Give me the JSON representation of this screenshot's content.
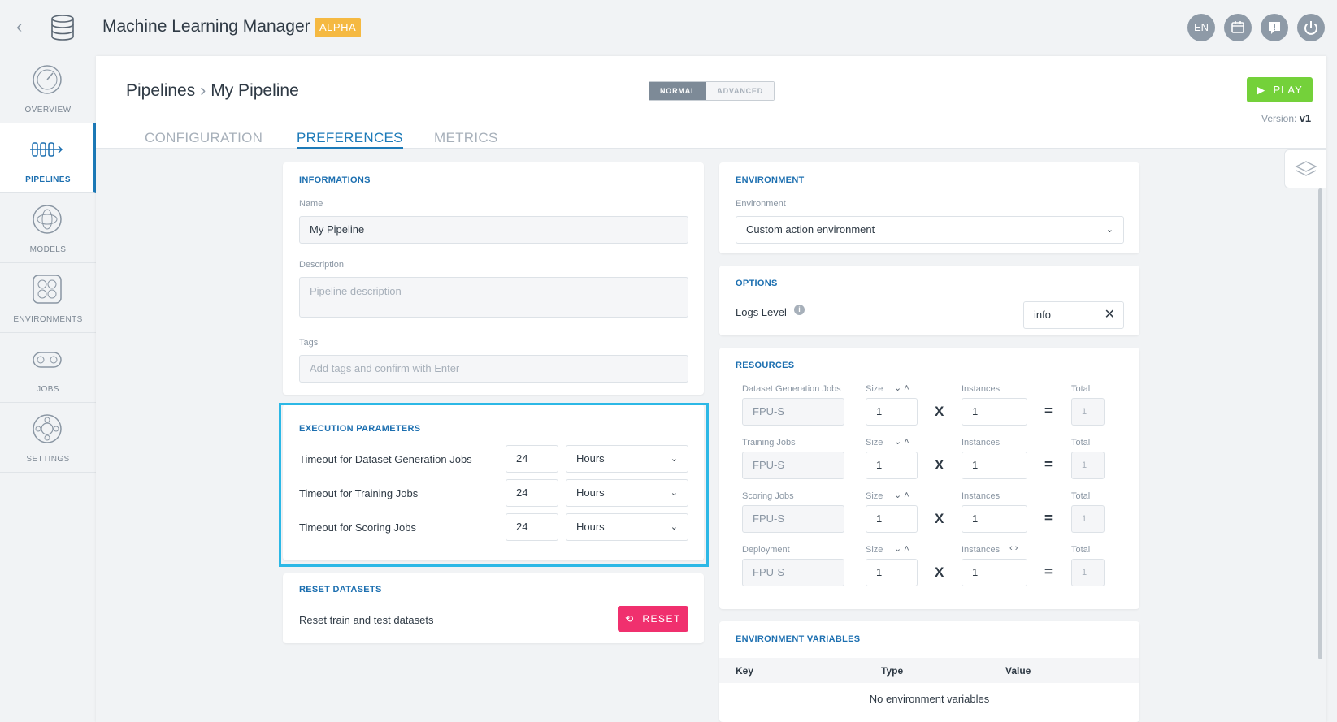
{
  "app": {
    "title": "Machine Learning Manager",
    "badge": "ALPHA"
  },
  "topbar": {
    "lang": "EN",
    "icons": [
      "calendar-icon",
      "feedback-icon",
      "power-icon"
    ]
  },
  "sidebar": {
    "items": [
      {
        "label": "OVERVIEW",
        "icon": "gauge-icon"
      },
      {
        "label": "PIPELINES",
        "icon": "pipeline-icon",
        "active": true
      },
      {
        "label": "MODELS",
        "icon": "model-icon"
      },
      {
        "label": "ENVIRONMENTS",
        "icon": "environment-icon"
      },
      {
        "label": "JOBS",
        "icon": "jobs-icon"
      },
      {
        "label": "SETTINGS",
        "icon": "settings-icon"
      }
    ]
  },
  "header": {
    "breadcrumb_root": "Pipelines",
    "breadcrumb_current": "My Pipeline",
    "mode_normal": "NORMAL",
    "mode_advanced": "ADVANCED",
    "play": "PLAY",
    "version_label": "Version:",
    "version_value": "v1"
  },
  "tabs": [
    "CONFIGURATION",
    "PREFERENCES",
    "METRICS"
  ],
  "informations": {
    "title": "INFORMATIONS",
    "name_label": "Name",
    "name_value": "My Pipeline",
    "description_label": "Description",
    "description_placeholder": "Pipeline description",
    "tags_label": "Tags",
    "tags_placeholder": "Add tags and confirm with Enter"
  },
  "execution": {
    "title": "EXECUTION PARAMETERS",
    "rows": [
      {
        "label": "Timeout for Dataset Generation Jobs",
        "value": "24",
        "unit": "Hours"
      },
      {
        "label": "Timeout for Training Jobs",
        "value": "24",
        "unit": "Hours"
      },
      {
        "label": "Timeout for Scoring Jobs",
        "value": "24",
        "unit": "Hours"
      }
    ]
  },
  "reset": {
    "title": "RESET DATASETS",
    "label": "Reset train and test datasets",
    "button": "RESET"
  },
  "environment": {
    "title": "ENVIRONMENT",
    "label": "Environment",
    "value": "Custom action environment"
  },
  "options": {
    "title": "OPTIONS",
    "logs_label": "Logs Level",
    "logs_value": "info"
  },
  "resources": {
    "title": "RESOURCES",
    "size_label": "Size",
    "instances_label": "Instances",
    "total_label": "Total",
    "rows": [
      {
        "label": "Dataset Generation Jobs",
        "type": "FPU-S",
        "size": "1",
        "instances": "1",
        "total": "1"
      },
      {
        "label": "Training Jobs",
        "type": "FPU-S",
        "size": "1",
        "instances": "1",
        "total": "1"
      },
      {
        "label": "Scoring Jobs",
        "type": "FPU-S",
        "size": "1",
        "instances": "1",
        "total": "1"
      },
      {
        "label": "Deployment",
        "type": "FPU-S",
        "size": "1",
        "instances": "1",
        "total": "1"
      }
    ]
  },
  "env_vars": {
    "title": "ENVIRONMENT VARIABLES",
    "col_key": "Key",
    "col_type": "Type",
    "col_value": "Value",
    "empty": "No environment variables"
  }
}
